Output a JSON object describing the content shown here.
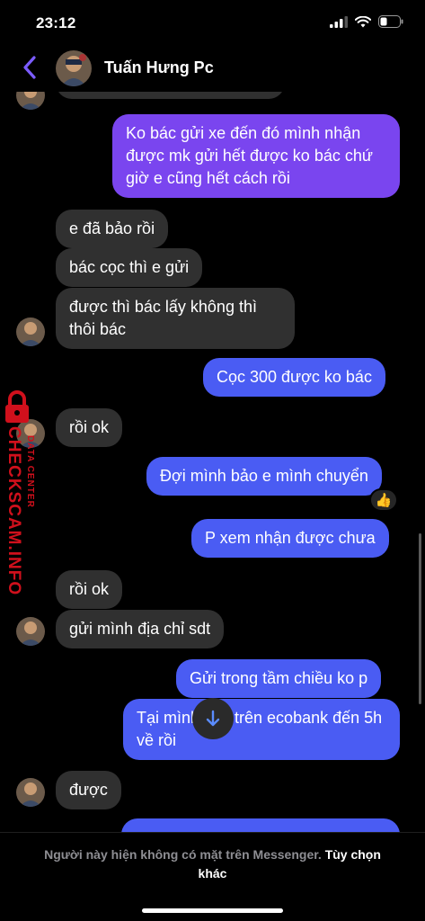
{
  "status_bar": {
    "time": "23:12"
  },
  "header": {
    "contact_name": "Tuấn Hưng Pc"
  },
  "messages": [
    {
      "from": "other",
      "text": ""
    },
    {
      "from": "me",
      "text": "Ko bác gửi xe đến đó mình nhận được mk  gửi hết được ko bác chứ giờ e cũng hết cách rồi"
    },
    {
      "from": "other",
      "text": "e đã bảo rồi"
    },
    {
      "from": "other",
      "text": "bác cọc thì e gửi"
    },
    {
      "from": "other",
      "text": "được thì bác lấy không thì thôi bác"
    },
    {
      "from": "me",
      "text": "Cọc 300 được ko bác"
    },
    {
      "from": "other",
      "text": "rồi ok"
    },
    {
      "from": "me",
      "text": "Đợi mình bảo e mình chuyển",
      "reaction": "👍"
    },
    {
      "from": "me",
      "text": "P xem nhận được chưa"
    },
    {
      "from": "other",
      "text": "rồi ok"
    },
    {
      "from": "other",
      "text": "gửi mình địa chỉ sdt"
    },
    {
      "from": "me",
      "text": "Gửi trong tầm chiều ko p"
    },
    {
      "from": "me",
      "text": "Tại mình làm trên ecobank đến 5h về rồi"
    },
    {
      "from": "other",
      "text": "được"
    }
  ],
  "watermark": {
    "main": "CHECKSCAM.INFO",
    "sub": "DATA CENTER"
  },
  "footer": {
    "notice": "Người này hiện không có mặt trên Messenger.",
    "link": "Tùy chọn khác"
  },
  "colors": {
    "accent": "#7b5cff",
    "incoming": "#303030",
    "outgoing_purple": "#7a45ef",
    "outgoing_blue": "#4a5cf3",
    "watermark": "#d0101c"
  },
  "icons": {
    "back": "chevron-left-icon",
    "signal": "signal-icon",
    "wifi": "wifi-icon",
    "battery": "battery-icon",
    "scroll": "arrow-down-icon"
  }
}
